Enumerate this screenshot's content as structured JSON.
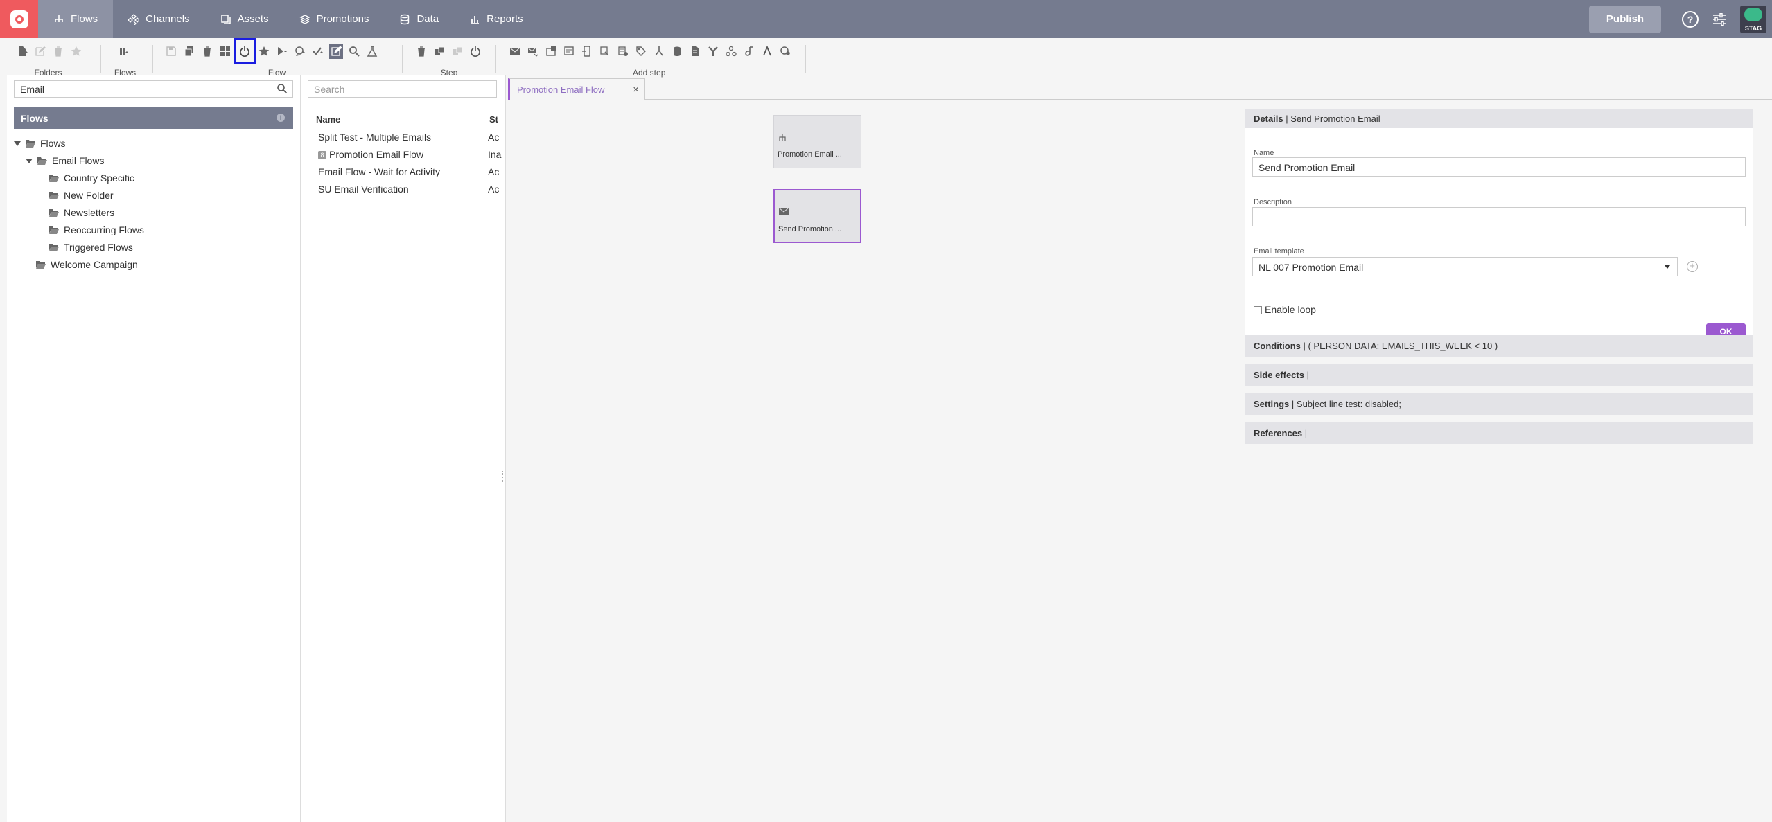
{
  "nav": {
    "tabs": [
      {
        "label": "Flows",
        "icon": "flows-icon"
      },
      {
        "label": "Channels",
        "icon": "channels-icon"
      },
      {
        "label": "Assets",
        "icon": "assets-icon"
      },
      {
        "label": "Promotions",
        "icon": "promotions-icon"
      },
      {
        "label": "Data",
        "icon": "data-icon"
      },
      {
        "label": "Reports",
        "icon": "reports-icon"
      }
    ],
    "publish_label": "Publish",
    "help_label": "?",
    "env_badge": "STAG"
  },
  "toolbar": {
    "groups": {
      "folders": "Folders",
      "flows": "Flows",
      "flow": "Flow",
      "step": "Step",
      "add_step": "Add step"
    }
  },
  "sidebar": {
    "search_value": "Email",
    "section_title": "Flows",
    "info_label": "i",
    "tree": [
      {
        "label": "Flows",
        "level": 0,
        "expanded": true
      },
      {
        "label": "Email Flows",
        "level": 1,
        "expanded": true
      },
      {
        "label": "Country Specific",
        "level": 2
      },
      {
        "label": "New Folder",
        "level": 2
      },
      {
        "label": "Newsletters",
        "level": 2
      },
      {
        "label": "Reoccurring Flows",
        "level": 2
      },
      {
        "label": "Triggered Flows",
        "level": 2
      },
      {
        "label": "Welcome Campaign",
        "level": 1
      }
    ]
  },
  "flowlist": {
    "search_placeholder": "Search",
    "columns": {
      "name": "Name",
      "status": "St"
    },
    "rows": [
      {
        "name": "Split Test - Multiple Emails",
        "status": "Ac",
        "badge": ""
      },
      {
        "name": "Promotion Email Flow",
        "status": "Ina",
        "badge": "8"
      },
      {
        "name": "Email Flow - Wait for Activity",
        "status": "Ac",
        "badge": ""
      },
      {
        "name": "SU Email Verification",
        "status": "Ac",
        "badge": ""
      }
    ]
  },
  "canvas": {
    "tab_title": "Promotion Email Flow",
    "tab_close": "×",
    "nodes": [
      {
        "label": "Promotion Email ...",
        "icon": "flow-start-icon"
      },
      {
        "label": "Send Promotion ...",
        "icon": "email-icon",
        "selected": true
      }
    ]
  },
  "details": {
    "header_bold": "Details",
    "header_rest": " | Send Promotion Email",
    "name_label": "Name",
    "name_value": "Send Promotion Email",
    "description_label": "Description",
    "description_value": "",
    "template_label": "Email template",
    "template_value": "NL 007 Promotion Email",
    "add_template": "+",
    "loop_label": "Enable loop",
    "ok_label": "OK",
    "sections": [
      {
        "title": "Conditions",
        "text": " | ( PERSON DATA: EMAILS_THIS_WEEK < 10 )"
      },
      {
        "title": "Side effects",
        "text": " |"
      },
      {
        "title": "Settings",
        "text": " | Subject line test: disabled;"
      },
      {
        "title": "References",
        "text": " |"
      }
    ]
  },
  "colors": {
    "nav_bg": "#757b8f",
    "brand": "#ef5a5e",
    "accent": "#9b59d0",
    "highlight": "#1a1de0"
  }
}
